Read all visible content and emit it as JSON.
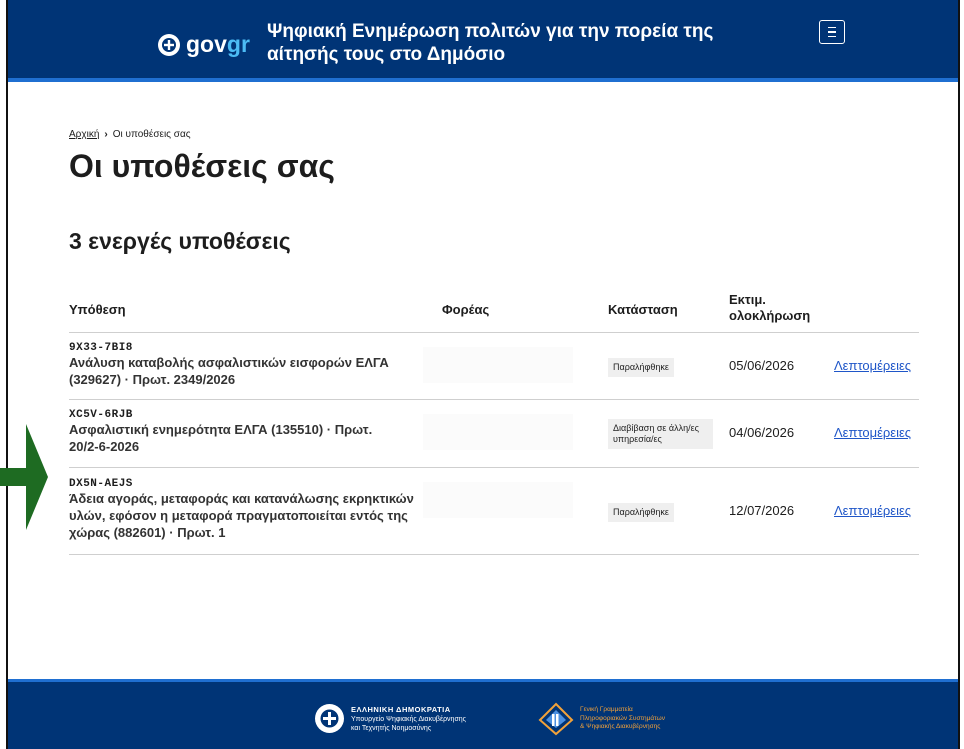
{
  "header": {
    "logo_text_gov": "gov",
    "logo_text_gr": "gr",
    "site_title": "Ψηφιακή Ενημέρωση πολιτών για την πορεία της αίτησής τους στο Δημόσιο",
    "menu_icon": "hamburger-icon"
  },
  "breadcrumb": {
    "home": "Αρχική",
    "separator": "›",
    "current": "Οι υποθέσεις σας"
  },
  "page_title": "Οι υποθέσεις σας",
  "active_count_heading": "3 ενεργές υποθέσεις",
  "table": {
    "headers": {
      "case": "Υπόθεση",
      "agency": "Φορέας",
      "status": "Κατάσταση",
      "estimated_line1": "Εκτιμ.",
      "estimated_line2": "ολοκλήρωση"
    },
    "rows": [
      {
        "code": "9X33-7BI8",
        "title": "Ανάλυση καταβολής ασφαλιστικών εισφορών ΕΛΓΑ (329627) · Πρωτ. 2349/2026",
        "status": "Παραλήφθηκε",
        "date": "05/06/2026",
        "details": "Λεπτομέρειες"
      },
      {
        "code": "XC5V-6RJB",
        "title": "Ασφαλιστική ενημερότητα ΕΛΓΑ (135510) · Πρωτ. 20/2-6-2026",
        "status": "Διαβίβαση σε άλλη/ες υπηρεσία/ες",
        "date": "04/06/2026",
        "details": "Λεπτομέρειες"
      },
      {
        "code": "DX5N-AEJS",
        "title": "Άδεια αγοράς, μεταφοράς και κατανάλωσης εκρηκτικών υλών, εφόσον η μεταφορά πραγματοποιείται εντός της χώρας (882601) · Πρωτ. 1",
        "status": "Παραλήφθηκε",
        "date": "12/07/2026",
        "details": "Λεπτομέρειες"
      }
    ]
  },
  "footer": {
    "left_line1": "ΕΛΛΗΝΙΚΗ ΔΗΜΟΚΡΑΤΙΑ",
    "left_line2": "Υπουργείο Ψηφιακής Διακυβέρνησης",
    "left_line3": "και Τεχνητής Νοημοσύνης",
    "right_line1": "Γενική Γραμματεία",
    "right_line2": "Πληροφοριακών Συστημάτων",
    "right_line3": "& Ψηφιακής Διακυβέρνησης"
  },
  "colors": {
    "header_bg": "#003476",
    "accent_line": "#1f6fd1",
    "link": "#1f56c8",
    "arrow": "#1e6b22"
  }
}
